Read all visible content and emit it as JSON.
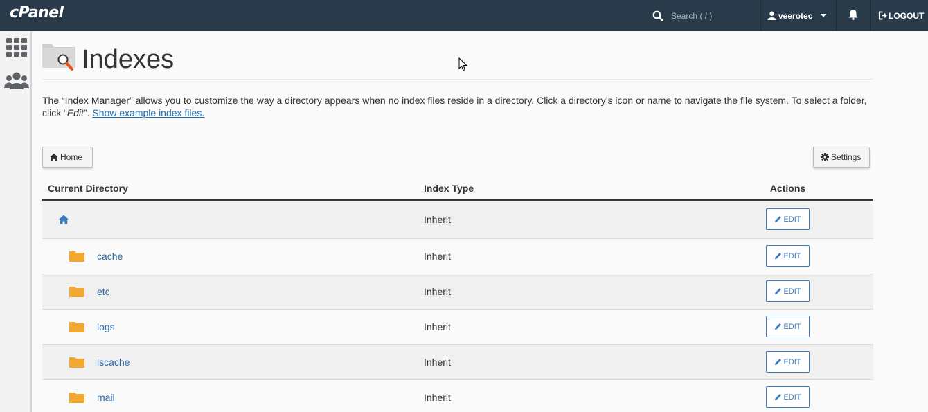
{
  "header": {
    "logo_text": "cPanel",
    "search_placeholder": "Search ( / )",
    "username": "veerotec",
    "logout_label": "LOGOUT"
  },
  "sidebar": {
    "items": [
      {
        "icon": "grid-icon"
      },
      {
        "icon": "users-icon"
      }
    ]
  },
  "page": {
    "title": "Indexes",
    "description_before_em": "The “Index Manager” allows you to customize the way a directory appears when no index files reside in a directory. Click a directory’s icon or name to navigate the file system. To select a folder, click “",
    "description_em": "Edit",
    "description_after_em": "”. ",
    "description_link": "Show example index files."
  },
  "toolbar": {
    "home_label": "Home",
    "settings_label": "Settings"
  },
  "table": {
    "headers": {
      "directory": "Current Directory",
      "index_type": "Index Type",
      "actions": "Actions"
    },
    "root_row": {
      "icon": "home-icon",
      "index_type": "Inherit",
      "action": "EDIT"
    },
    "rows": [
      {
        "name": "cache",
        "index_type": "Inherit",
        "action": "EDIT"
      },
      {
        "name": "etc",
        "index_type": "Inherit",
        "action": "EDIT"
      },
      {
        "name": "logs",
        "index_type": "Inherit",
        "action": "EDIT"
      },
      {
        "name": "lscache",
        "index_type": "Inherit",
        "action": "EDIT"
      },
      {
        "name": "mail",
        "index_type": "Inherit",
        "action": "EDIT"
      }
    ]
  },
  "colors": {
    "topbar": "#293a4a",
    "link": "#2b6aa8",
    "folder": "#f0a830",
    "edit_border": "#3b7bbf"
  }
}
